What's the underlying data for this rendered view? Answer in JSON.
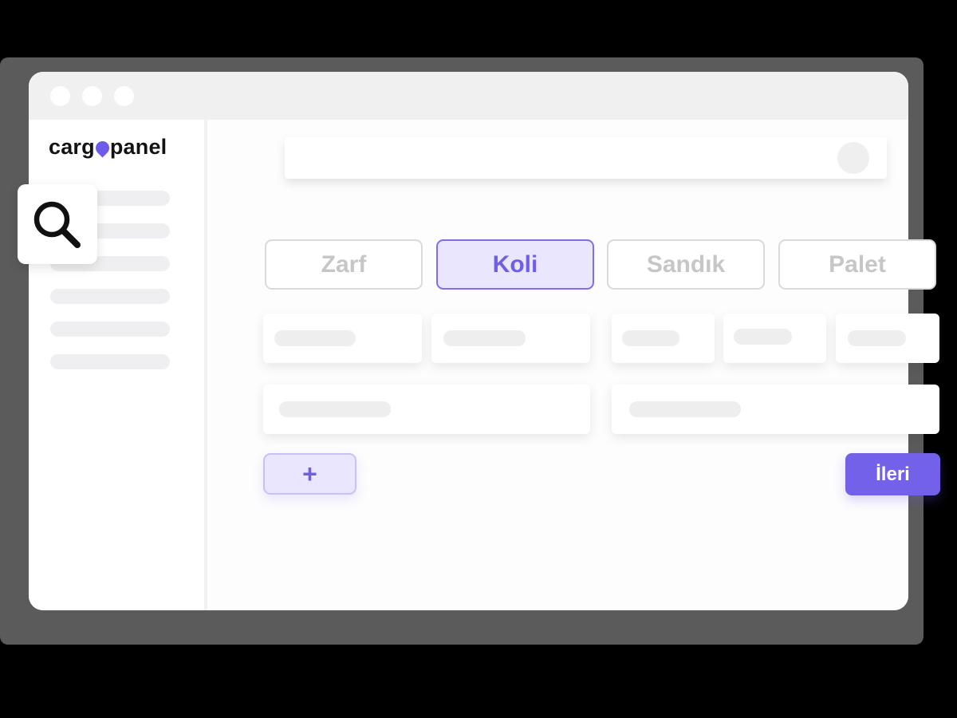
{
  "logo": {
    "part1": "carg",
    "part2": "panel"
  },
  "tabs": [
    {
      "label": "Zarf",
      "active": false
    },
    {
      "label": "Koli",
      "active": true
    },
    {
      "label": "Sandık",
      "active": false
    },
    {
      "label": "Palet",
      "active": false
    }
  ],
  "buttons": {
    "add_label": "+",
    "next_label": "İleri"
  },
  "icons": {
    "search": "search-icon",
    "logo_mark": "location-pin-icon",
    "avatar": "avatar"
  },
  "colors": {
    "accent": "#7461ea",
    "accent_light": "#e9e6fd",
    "placeholder": "#eeeeee",
    "frame": "#5b5b5b"
  }
}
